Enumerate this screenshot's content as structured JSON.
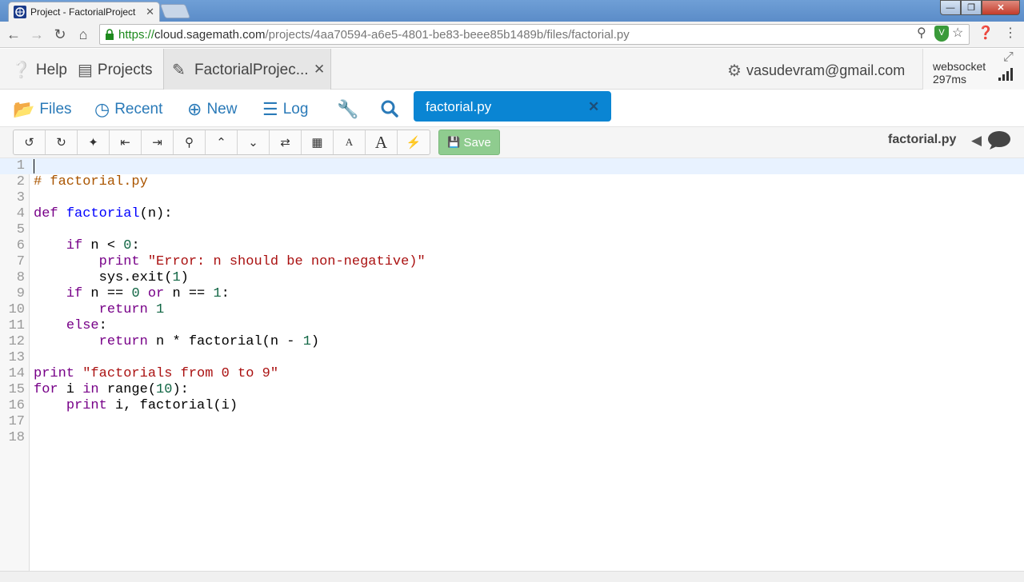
{
  "browser": {
    "tab_title": "Project - FactorialProject",
    "tab_close": "✕",
    "url_https": "https://",
    "url_host": "cloud.sagemath.com",
    "url_path": "/projects/4aa70594-a6e5-4801-be83-beee85b1489b/files/factorial.py",
    "win_min": "—",
    "win_max": "❐",
    "win_close": "✕"
  },
  "topbar": {
    "help": "Help",
    "projects": "Projects",
    "project_tab": "FactorialProjec...",
    "project_tab_close": "✕",
    "account": "vasudevram@gmail.com",
    "websocket_label": "websocket",
    "websocket_ms": "297ms"
  },
  "filenav": {
    "files": "Files",
    "recent": "Recent",
    "new": "New",
    "log": "Log",
    "open_file": "factorial.py",
    "open_file_close": "✕"
  },
  "toolbar": {
    "buttons": [
      "undo-icon",
      "redo-icon",
      "magic-wand-icon",
      "unindent-icon",
      "indent-icon",
      "search-icon",
      "chevron-up-icon",
      "chevron-down-icon",
      "replace-icon",
      "film-icon",
      "font-small-icon",
      "font-large-icon",
      "bolt-icon"
    ],
    "save_label": "Save",
    "filename": "factorial.py"
  },
  "editor": {
    "line_numbers": [
      "1",
      "2",
      "3",
      "4",
      "5",
      "6",
      "7",
      "8",
      "9",
      "10",
      "11",
      "12",
      "13",
      "14",
      "15",
      "16",
      "17",
      "18"
    ],
    "lines": [
      "",
      "# factorial.py",
      "",
      "def factorial(n):",
      "",
      "    if n < 0:",
      "        print \"Error: n should be non-negative)\"",
      "        sys.exit(1)",
      "    if n == 0 or n == 1:",
      "        return 1",
      "    else:",
      "        return n * factorial(n - 1)",
      "",
      "print \"factorials from 0 to 9\"",
      "for i in range(10):",
      "    print i, factorial(i)",
      "",
      ""
    ]
  },
  "colors": {
    "accent": "#0a85d3",
    "link": "#2a7ab8",
    "save": "#8fcc8f",
    "keyword": "#770088",
    "string": "#aa1111",
    "number": "#116644",
    "comment": "#aa5500"
  }
}
